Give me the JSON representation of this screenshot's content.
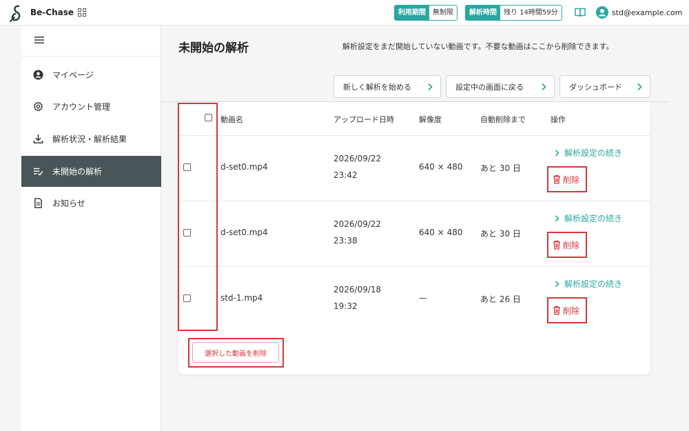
{
  "header": {
    "brand": "Be-Chase",
    "usage_period_label": "利用期間",
    "usage_period_value": "無制限",
    "analysis_time_label": "解析時間",
    "analysis_time_value": "残り 14時間59分",
    "user_email": "std@example.com"
  },
  "sidebar": {
    "items": [
      {
        "label": "マイページ",
        "icon": "user-circle-icon"
      },
      {
        "label": "アカウント管理",
        "icon": "gear-icon"
      },
      {
        "label": "解析状況・解析結果",
        "icon": "download-icon"
      },
      {
        "label": "未開始の解析",
        "icon": "list-check-icon",
        "active": true
      },
      {
        "label": "お知らせ",
        "icon": "document-icon"
      }
    ]
  },
  "page": {
    "title": "未開始の解析",
    "description": "解析設定をまだ開始していない動画です。不要な動画はここから削除できます。",
    "buttons": {
      "new_analysis": "新しく解析を始める",
      "back_to_setup": "設定中の画面に戻る",
      "dashboard": "ダッシュボード"
    }
  },
  "table": {
    "headers": {
      "name": "動画名",
      "uploaded": "アップロード日時",
      "resolution": "解像度",
      "auto_delete": "自動削除まで",
      "actions": "操作"
    },
    "rows": [
      {
        "name": "d-set0.mp4",
        "date": "2026/09/22",
        "time": "23:42",
        "resolution": "640 × 480",
        "auto_delete": "あと 30 日",
        "continue": "解析設定の続き",
        "delete": "削除"
      },
      {
        "name": "d-set0.mp4",
        "date": "2026/09/22",
        "time": "23:38",
        "resolution": "640 × 480",
        "auto_delete": "あと 30 日",
        "continue": "解析設定の続き",
        "delete": "削除"
      },
      {
        "name": "std-1.mp4",
        "date": "2026/09/18",
        "time": "19:32",
        "resolution": "—",
        "auto_delete": "あと 26 日",
        "continue": "解析設定の続き",
        "delete": "削除"
      }
    ],
    "bulk_delete": "選択した動画を削除"
  },
  "colors": {
    "accent": "#2aa7a1",
    "danger": "#d6343a",
    "sidebar_active": "#4a5559"
  }
}
